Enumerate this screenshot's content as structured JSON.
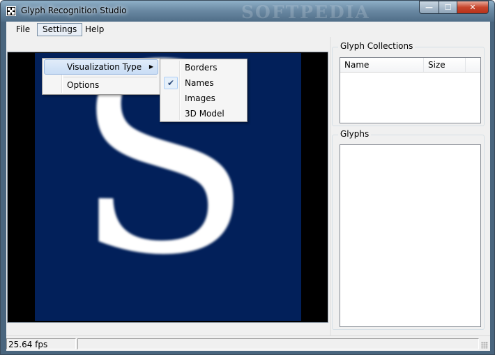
{
  "window": {
    "title": "Glyph Recognition Studio",
    "watermark": "SOFTPEDIA",
    "watermark_small": "SOFTPEDIA",
    "controls": {
      "minimize": "—",
      "maximize": "☐",
      "close": "✕"
    },
    "icon": "app-icon"
  },
  "menubar": {
    "file": "File",
    "settings": "Settings",
    "help": "Help"
  },
  "settings_menu": {
    "visualization_type": "Visualization Type",
    "submenu_arrow": "▶",
    "options": "Options"
  },
  "visualization_submenu": {
    "items": [
      "Borders",
      "Names",
      "Images",
      "3D Model"
    ],
    "checked": "Names",
    "check_glyph": "✔"
  },
  "viewer": {
    "glyph": "S",
    "background_color": "#02205a"
  },
  "panels": {
    "collections_title": "Glyph Collections",
    "columns": {
      "name": "Name",
      "size": "Size"
    },
    "glyphs_title": "Glyphs"
  },
  "status": {
    "fps": "25.64 fps",
    "message": ""
  }
}
